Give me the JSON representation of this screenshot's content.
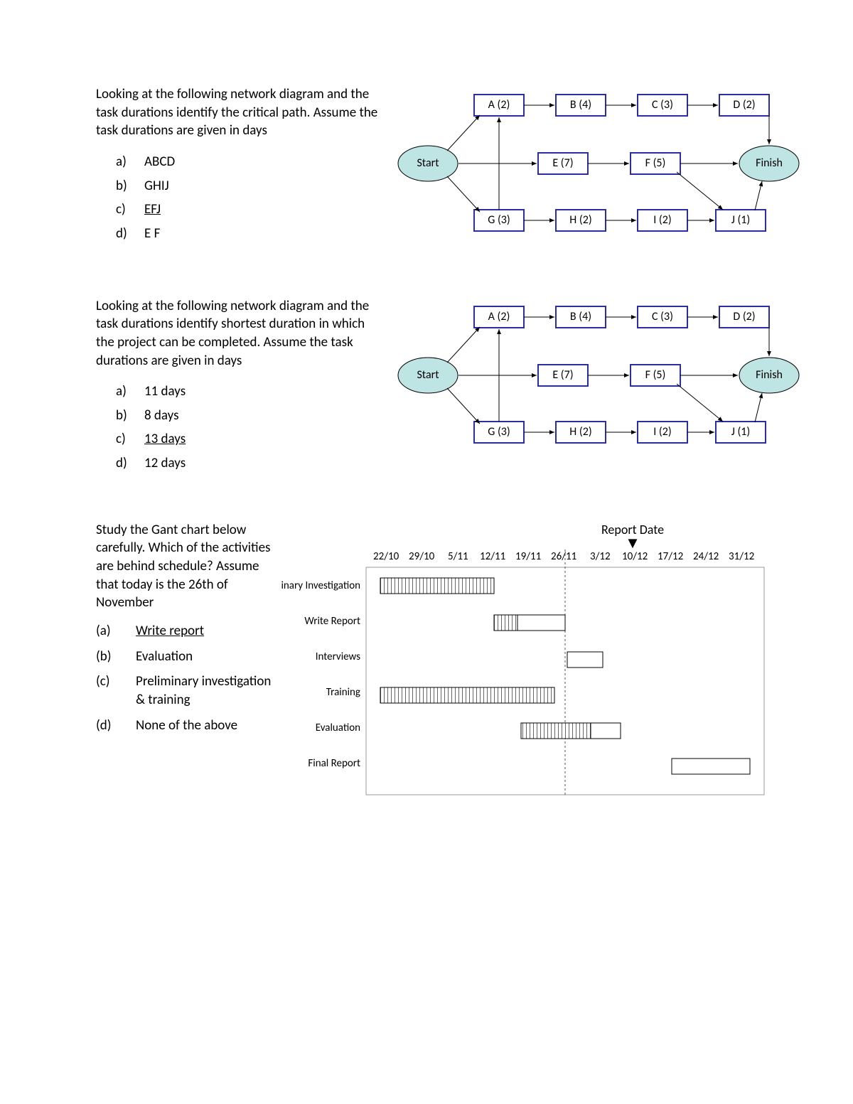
{
  "q1": {
    "prompt": "Looking at the following network diagram and the task durations identify the critical path. Assume the task durations are given in days",
    "options": {
      "a": {
        "label": "a)",
        "text": "ABCD",
        "under": false
      },
      "b": {
        "label": "b)",
        "text": "GHIJ",
        "under": false
      },
      "c": {
        "label": "c)",
        "text": "EFJ",
        "under": true
      },
      "d": {
        "label": "d)",
        "text": "E F",
        "under": false
      }
    }
  },
  "q2": {
    "prompt": "Looking at the following network diagram and the task durations identify shortest duration in which the project can be completed. Assume the task durations are given in days",
    "options": {
      "a": {
        "label": "a)",
        "text": "11 days",
        "under": false
      },
      "b": {
        "label": "b)",
        "text": "8 days",
        "under": false
      },
      "c": {
        "label": "c)",
        "text": "13 days",
        "under": true
      },
      "d": {
        "label": "d)",
        "text": "12 days",
        "under": false
      }
    }
  },
  "q3": {
    "prompt": "Study the Gant chart below carefully. Which of the activities are behind schedule? Assume that today is the 26th of November",
    "options": {
      "a": {
        "label": "(a)",
        "text": "Write report",
        "under": true
      },
      "b": {
        "label": "(b)",
        "text": "Evaluation",
        "under": false
      },
      "c": {
        "label": "(c)",
        "text": "Preliminary investigation & training",
        "under": false
      },
      "d": {
        "label": "(d)",
        "text": "None of the above",
        "under": false
      }
    }
  },
  "network": {
    "start": "Start",
    "finish": "Finish",
    "boxes": {
      "A": "A (2)",
      "B": "B (4)",
      "C": "C (3)",
      "D": "D (2)",
      "E": "E (7)",
      "F": "F (5)",
      "G": "G (3)",
      "H": "H (2)",
      "I": "I (2)",
      "J": "J (1)"
    }
  },
  "gantt": {
    "title": "Report Date",
    "dates": [
      "22/10",
      "29/10",
      "5/11",
      "12/11",
      "19/11",
      "26/11",
      "3/12",
      "10/12",
      "17/12",
      "24/12",
      "31/12"
    ],
    "tasks": [
      "Preliminary Investigation",
      "Write Report",
      "Interviews",
      "Training",
      "Evaluation",
      "Final Report"
    ],
    "chart_data": {
      "type": "gantt",
      "today": "26/11",
      "rows": [
        {
          "name": "Preliminary Investigation",
          "start": "22/10",
          "end": "12/11",
          "progress": 1.0
        },
        {
          "name": "Write Report",
          "start": "12/11",
          "end": "26/11",
          "progress": 0.33
        },
        {
          "name": "Interviews",
          "start": "26/11",
          "end": "3/12",
          "progress": 0.0
        },
        {
          "name": "Training",
          "start": "22/10",
          "end": "24/11",
          "progress": 1.0
        },
        {
          "name": "Evaluation",
          "start": "17/11",
          "end": "7/12",
          "progress": 0.7
        },
        {
          "name": "Final Report",
          "start": "17/12",
          "end": "31/12",
          "progress": 0.0
        }
      ]
    }
  }
}
